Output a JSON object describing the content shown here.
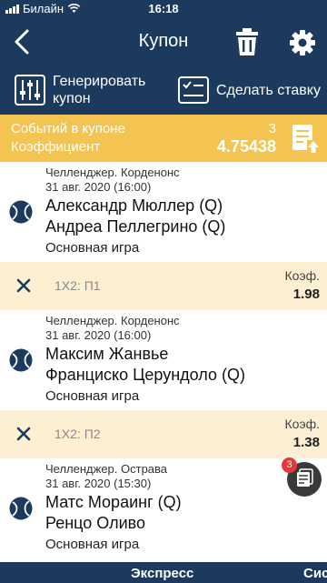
{
  "status_bar": {
    "carrier": "Билайн",
    "time": "16:18"
  },
  "header": {
    "title": "Купон"
  },
  "actions": {
    "generate_line1": "Генерировать",
    "generate_line2": "купон",
    "place_bet": "Сделать ставку"
  },
  "summary": {
    "events_label": "Событий в купоне",
    "events_count": "3",
    "coef_label": "Коэффициент",
    "coef_value": "4.75438"
  },
  "events": [
    {
      "tournament": "Челленджер. Корденонс",
      "date": "31 авг. 2020 (16:00)",
      "player1": "Александр Мюллер (Q)",
      "player2": "Андреа Пеллегрино (Q)",
      "market": "Основная игра",
      "selection": "1X2: П1",
      "coef_label": "Коэф.",
      "coef": "1.98"
    },
    {
      "tournament": "Челленджер. Корденонс",
      "date": "31 авг. 2020 (16:00)",
      "player1": "Максим Жанвье",
      "player2": "Франциско Церундоло (Q)",
      "market": "Основная игра",
      "selection": "1X2: П2",
      "coef_label": "Коэф.",
      "coef": "1.38"
    },
    {
      "tournament": "Челленджер. Острава",
      "date": "31 авг. 2020 (15:30)",
      "player1": "Матс Мораинг (Q)",
      "player2": "Ренцо Оливо",
      "market": "Основная игра"
    }
  ],
  "floating_badge": "3",
  "bottom_tabs": {
    "express": "Экспресс",
    "system": "Сис"
  },
  "colors": {
    "navy": "#1c3a5e",
    "gold": "#f3c451",
    "bet_row": "#fcefd2",
    "badge_red": "#e53935"
  }
}
